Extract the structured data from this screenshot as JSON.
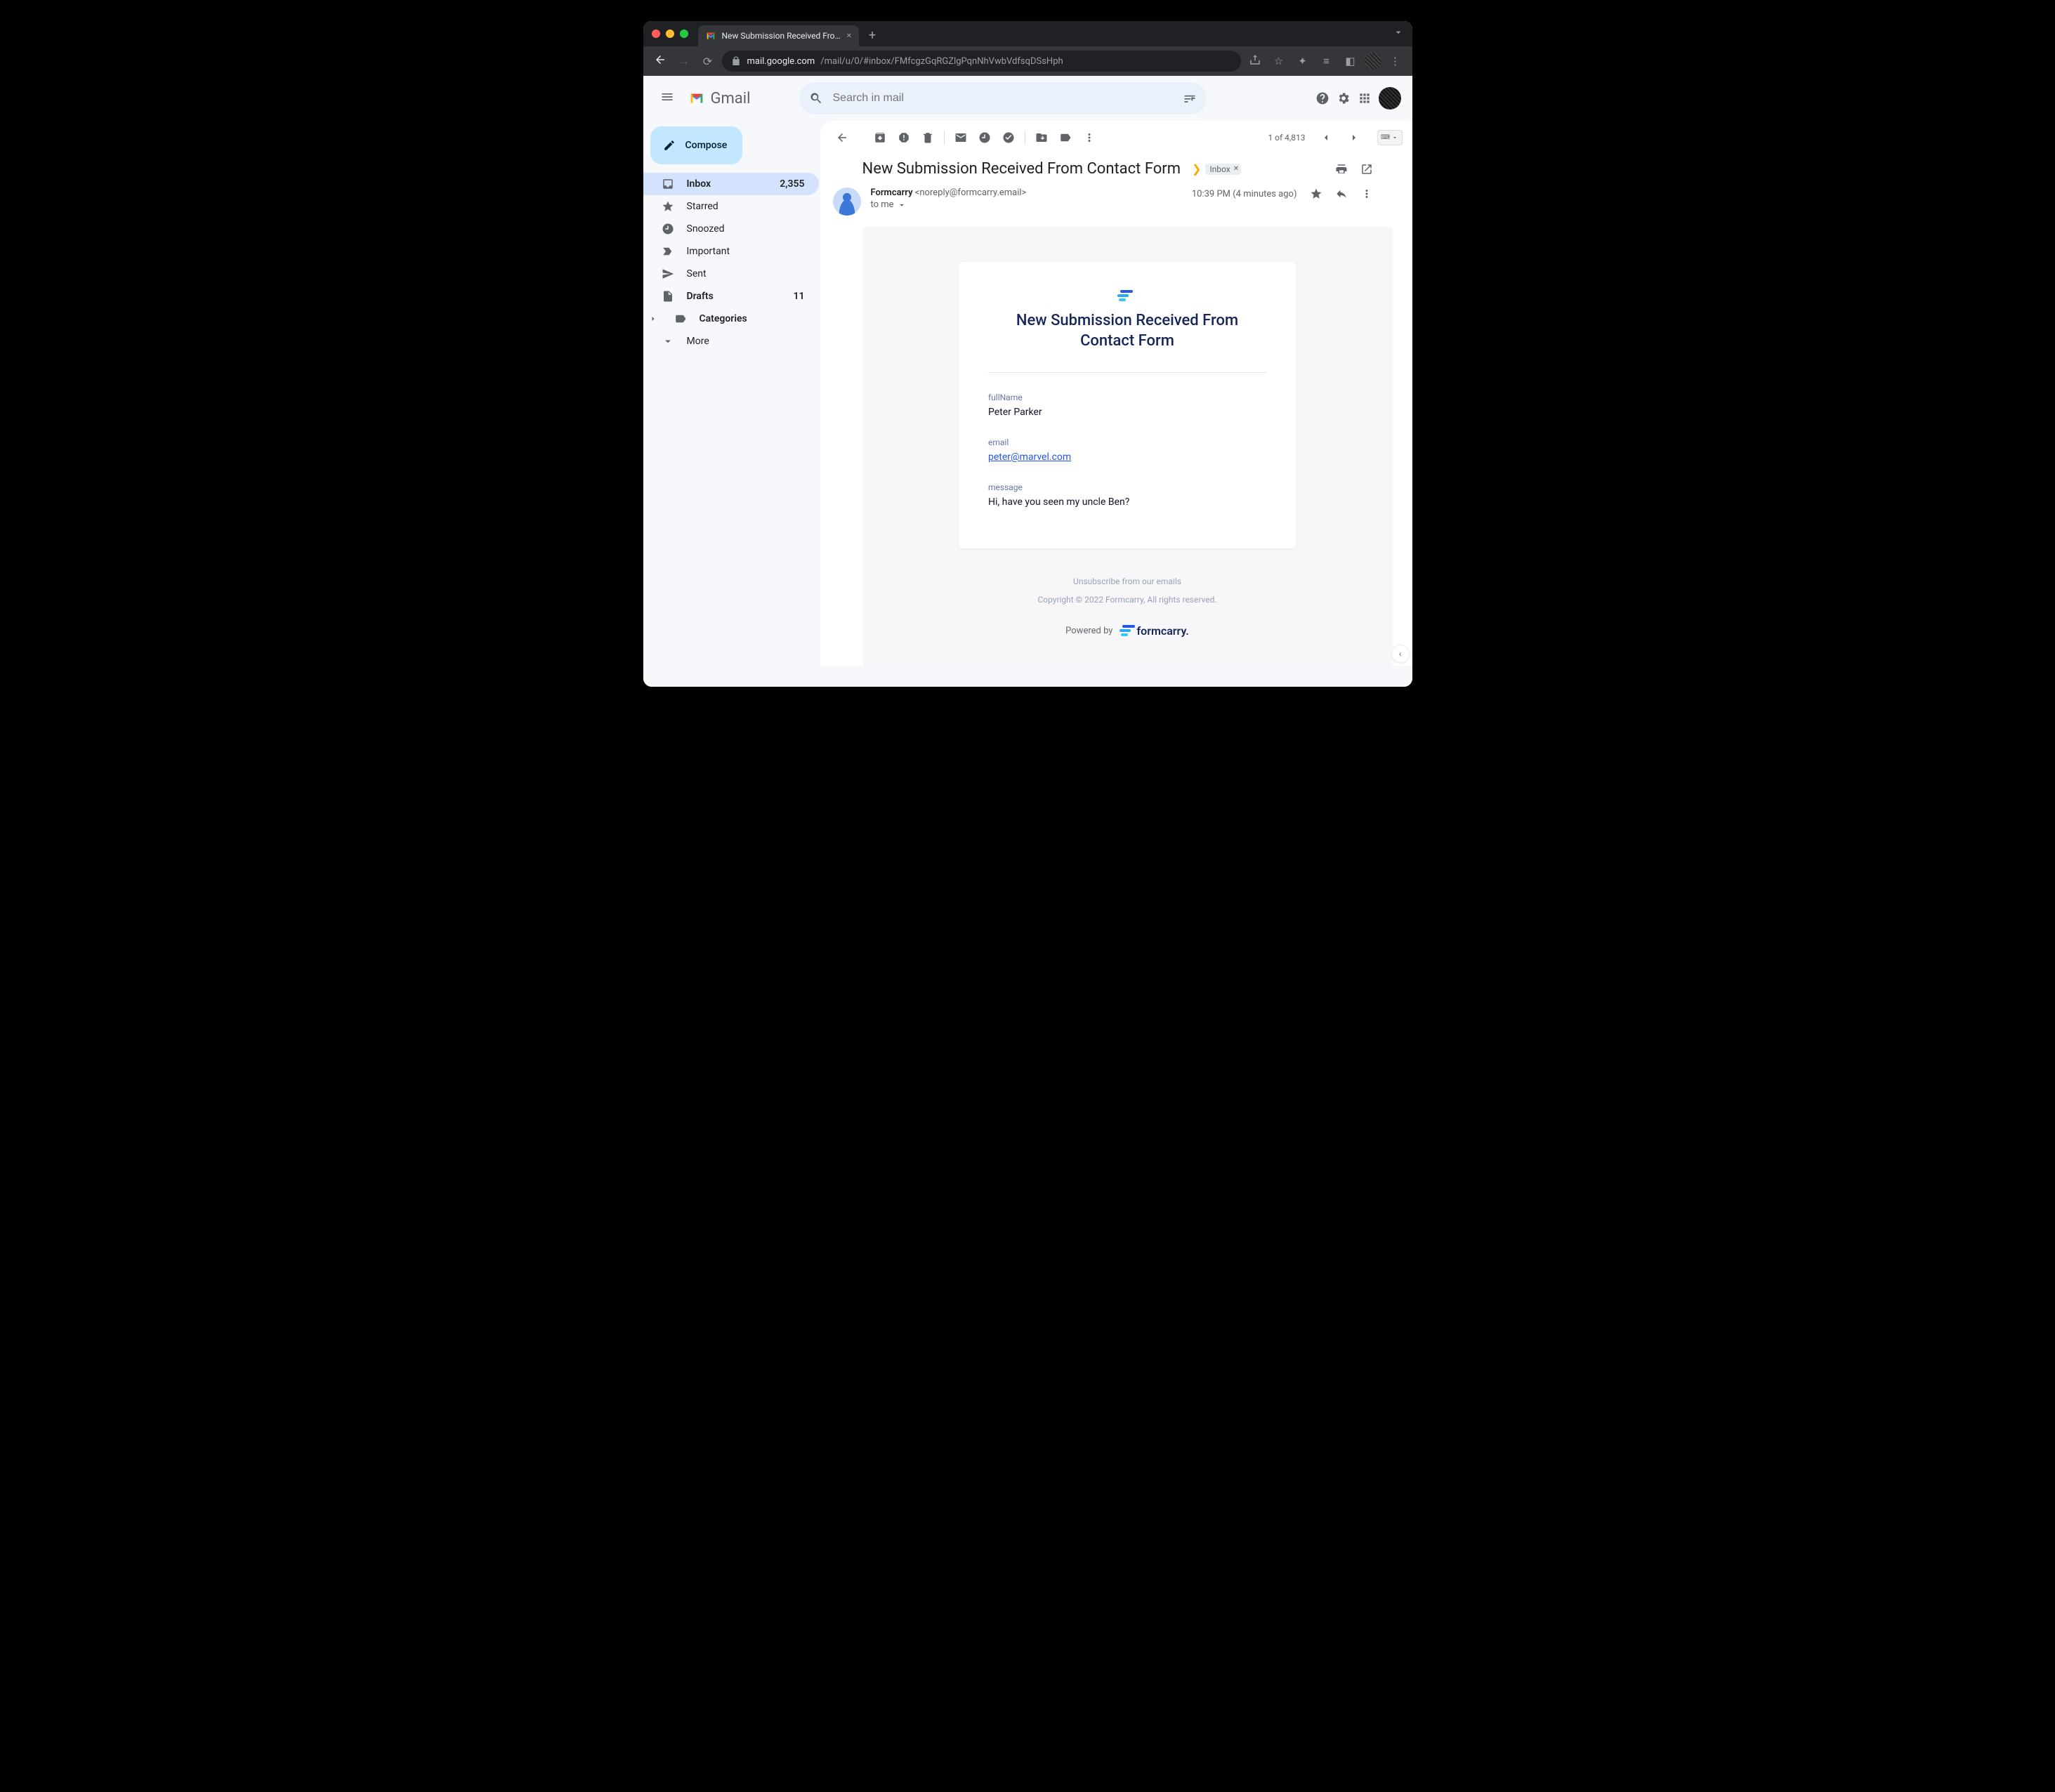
{
  "browser": {
    "tab_title": "New Submission Received Fro…",
    "new_tab_glyph": "+",
    "url_host": "mail.google.com",
    "url_path": "/mail/u/0/#inbox/FMfcgzGqRGZlgPqnNhVwbVdfsqDSsHph"
  },
  "header": {
    "brand": "Gmail",
    "search_placeholder": "Search in mail"
  },
  "sidebar": {
    "compose": "Compose",
    "items": [
      {
        "icon": "inbox",
        "label": "Inbox",
        "badge": "2,355",
        "active": true,
        "bold": true
      },
      {
        "icon": "star",
        "label": "Starred"
      },
      {
        "icon": "clock",
        "label": "Snoozed"
      },
      {
        "icon": "important",
        "label": "Important"
      },
      {
        "icon": "send",
        "label": "Sent"
      },
      {
        "icon": "draft",
        "label": "Drafts",
        "badge": "11",
        "bold": true
      },
      {
        "icon": "label",
        "label": "Categories",
        "bold": true,
        "caret": true
      },
      {
        "icon": "more",
        "label": "More"
      }
    ]
  },
  "toolbar": {
    "counter": "1 of 4,813"
  },
  "subject": {
    "text": "New Submission Received From Contact Form",
    "label": "Inbox"
  },
  "meta": {
    "sender_name": "Formcarry",
    "sender_email": "<noreply@formcarry.email>",
    "to_line": "to me",
    "timestamp": "10:39 PM (4 minutes ago)"
  },
  "body": {
    "title": "New Submission Received From Contact Form",
    "fields": [
      {
        "k": "fullName",
        "v": "Peter Parker",
        "link": false
      },
      {
        "k": "email",
        "v": "peter@marvel.com",
        "link": true
      },
      {
        "k": "message",
        "v": "Hi, have you seen my uncle Ben?",
        "link": false
      }
    ],
    "unsubscribe": "Unsubscribe from our emails",
    "copyright": "Copyright © 2022 Formcarry, All rights reserved.",
    "powered_by": "Powered by",
    "brand": "formcarry."
  }
}
